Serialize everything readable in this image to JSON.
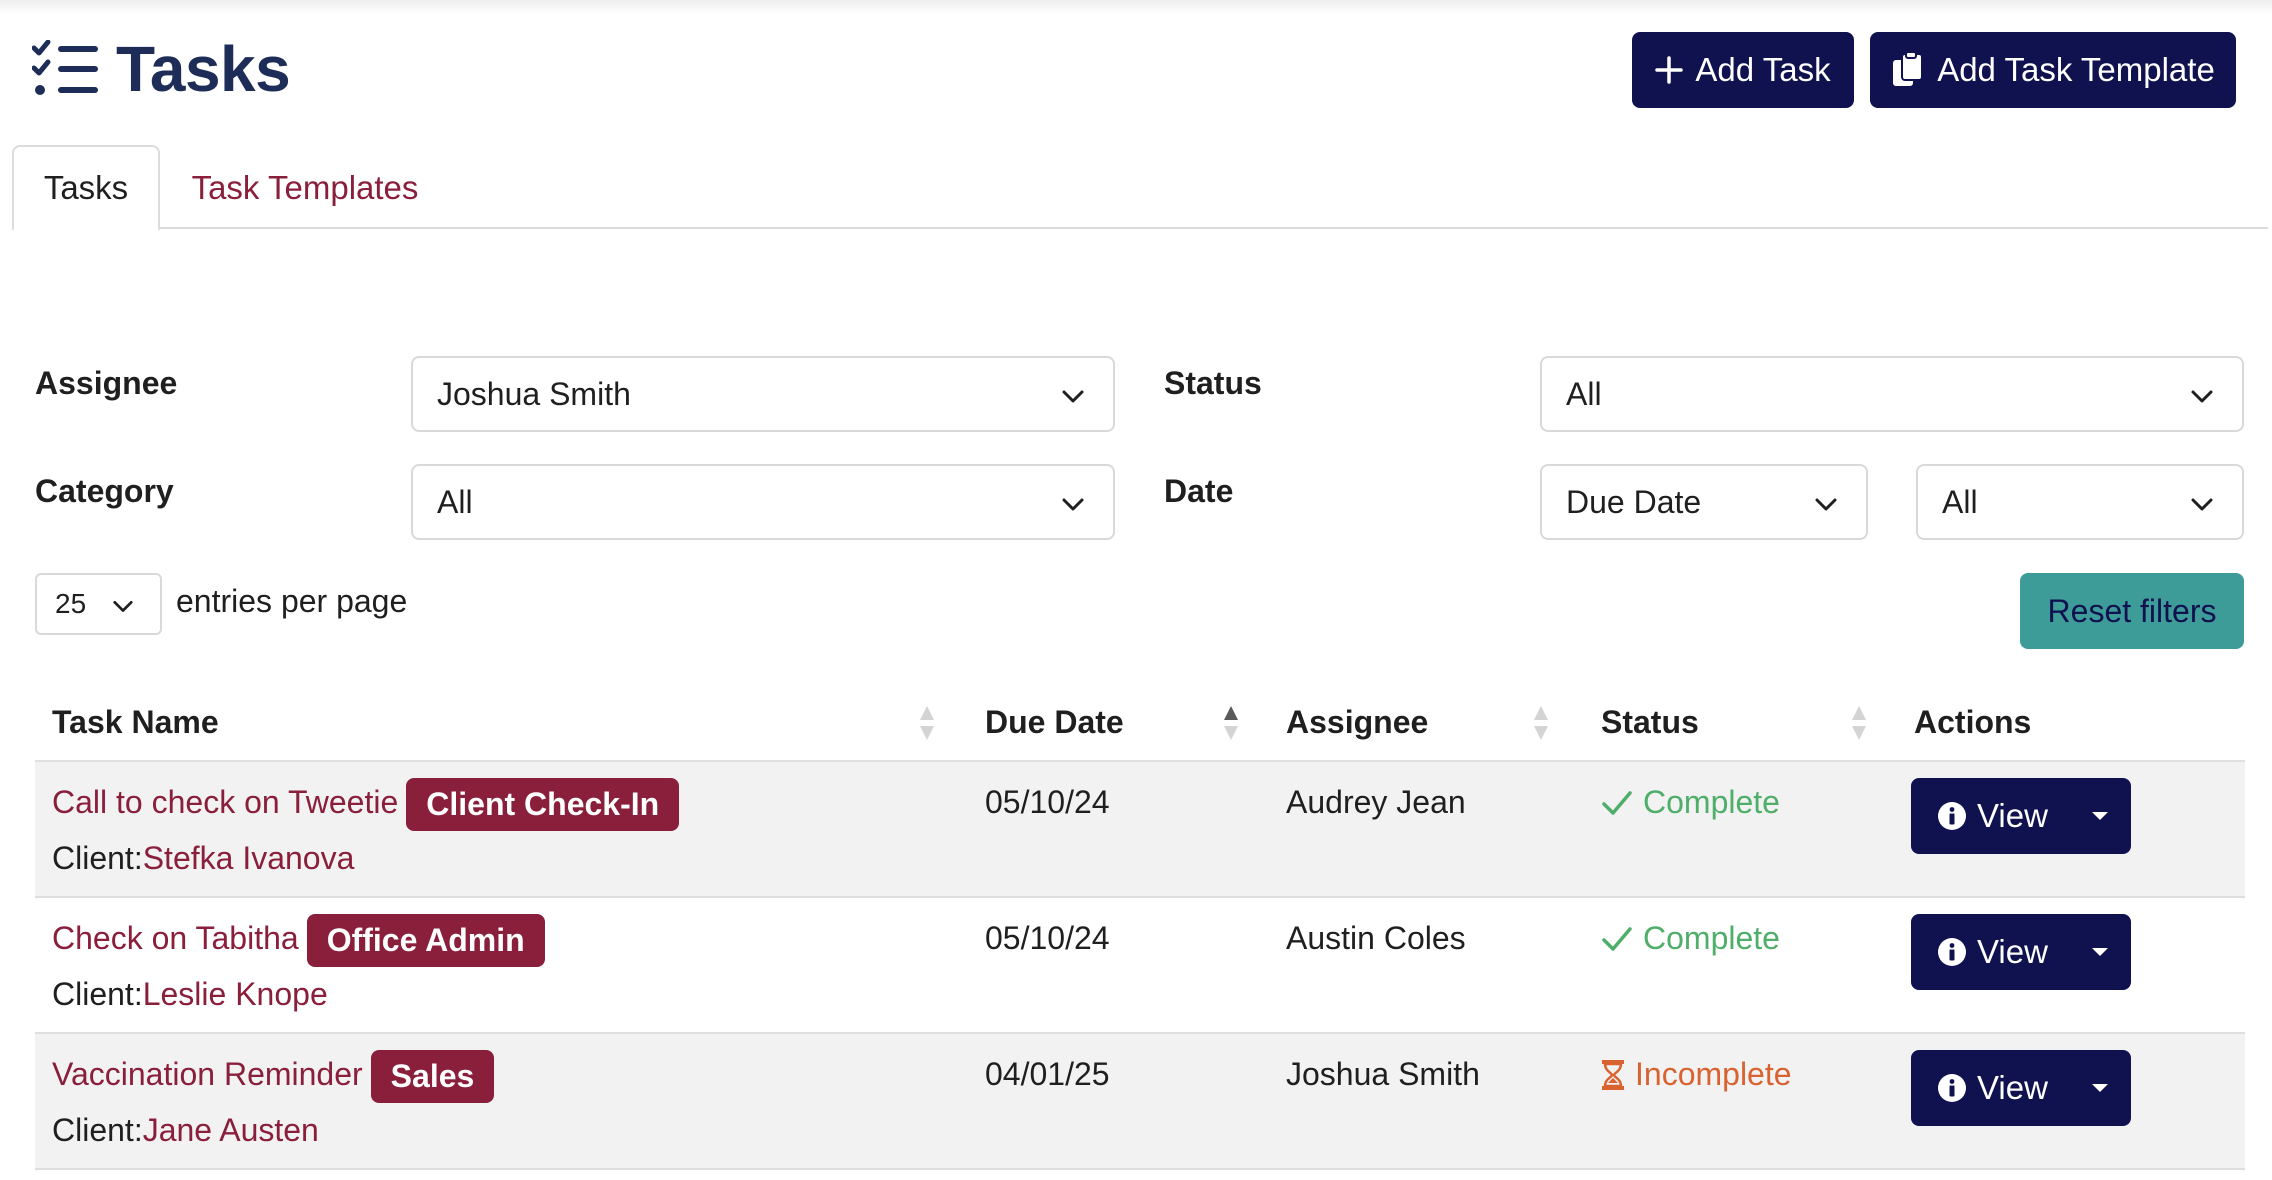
{
  "header": {
    "title": "Tasks",
    "add_task_label": "Add Task",
    "add_template_label": "Add Task Template"
  },
  "tabs": [
    {
      "label": "Tasks",
      "active": true
    },
    {
      "label": "Task Templates",
      "active": false
    }
  ],
  "filters": {
    "assignee_label": "Assignee",
    "assignee_value": "Joshua Smith",
    "status_label": "Status",
    "status_value": "All",
    "category_label": "Category",
    "category_value": "All",
    "date_label": "Date",
    "date_field_value": "Due Date",
    "date_range_value": "All"
  },
  "pagination": {
    "page_size": "25",
    "entries_label": "entries per page"
  },
  "reset_label": "Reset filters",
  "table": {
    "columns": [
      "Task Name",
      "Due Date",
      "Assignee",
      "Status",
      "Actions"
    ],
    "sorted_column": "Due Date",
    "sort_direction": "ascending",
    "rows": [
      {
        "task_name": "Call to check on Tweetie",
        "category": "Client Check-In",
        "client_prefix": "Client:",
        "client": "Stefka Ivanova",
        "due_date": "05/10/24",
        "assignee": "Audrey Jean",
        "status": "Complete",
        "status_icon": "check-icon",
        "action": "View"
      },
      {
        "task_name": "Check on Tabitha",
        "category": "Office Admin",
        "client_prefix": "Client:",
        "client": "Leslie Knope",
        "due_date": "05/10/24",
        "assignee": "Austin Coles",
        "status": "Complete",
        "status_icon": "check-icon",
        "action": "View"
      },
      {
        "task_name": "Vaccination Reminder",
        "category": "Sales",
        "client_prefix": "Client:",
        "client": "Jane Austen",
        "due_date": "04/01/25",
        "assignee": "Joshua Smith",
        "status": "Incomplete",
        "status_icon": "hourglass-icon",
        "action": "View"
      }
    ]
  },
  "colors": {
    "brand_navy": "#10124f",
    "title_navy": "#1d2d58",
    "accent_maroon": "#8a1f3b",
    "reset_teal": "#3d9b98",
    "complete_green": "#4fae6a",
    "incomplete_orange": "#d96330"
  }
}
